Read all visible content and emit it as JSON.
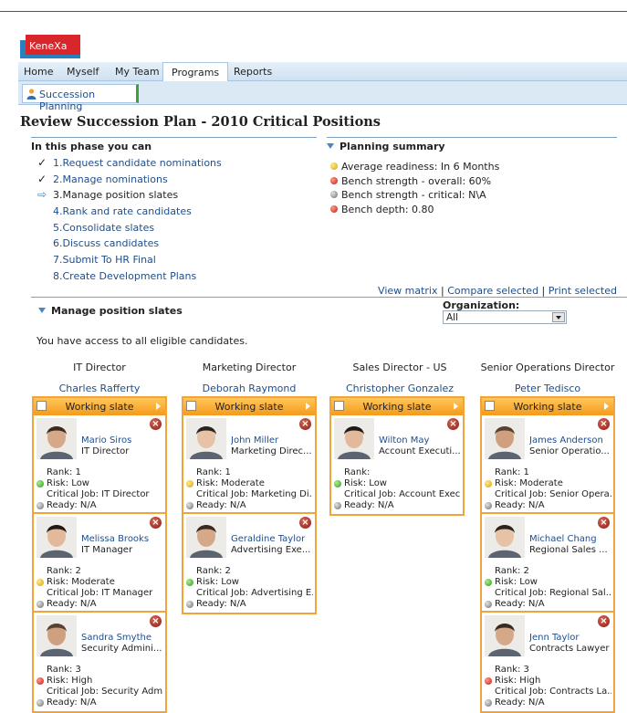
{
  "app": {
    "logo_text": "KeneXa"
  },
  "nav": {
    "items": [
      "Home",
      "Myself",
      "My Team",
      "Programs",
      "Reports"
    ],
    "active": "Programs"
  },
  "subtab": {
    "label": "Succession Planning"
  },
  "page_title": "Review Succession Plan - 2010 Critical Positions",
  "phase": {
    "heading": "In this phase you can",
    "items": [
      {
        "label": "1.Request candidate nominations",
        "mark": "check"
      },
      {
        "label": "2.Manage nominations",
        "mark": "check"
      },
      {
        "label": "3.Manage position slates",
        "mark": "arrow"
      },
      {
        "label": "4.Rank and rate candidates",
        "mark": ""
      },
      {
        "label": "5.Consolidate slates",
        "mark": ""
      },
      {
        "label": "6.Discuss candidates",
        "mark": ""
      },
      {
        "label": "7.Submit To HR Final",
        "mark": ""
      },
      {
        "label": "8.Create Development Plans",
        "mark": ""
      }
    ]
  },
  "summary": {
    "heading": "Planning summary",
    "items": [
      {
        "label": "Average readiness: In 6 Months",
        "color": "yellow"
      },
      {
        "label": "Bench strength - overall: 60%",
        "color": "red"
      },
      {
        "label": "Bench strength - critical: N\\A",
        "color": "gray"
      },
      {
        "label": "Bench depth: 0.80",
        "color": "red"
      }
    ]
  },
  "links": {
    "view_matrix": "View matrix",
    "compare_selected": "Compare selected",
    "print_selected": "Print selected",
    "sep": "|"
  },
  "manage": {
    "heading": "Manage position slates",
    "org_label": "Organization:",
    "org_value": "All",
    "access_text": "You have access to all eligible candidates."
  },
  "slate_label": "Working slate",
  "labels": {
    "rank": "Rank:",
    "risk": "Risk:",
    "critical_job": "Critical Job:",
    "ready": "Ready:"
  },
  "columns": [
    {
      "title": "IT Director",
      "person": "Charles  Rafferty",
      "candidates": [
        {
          "name": "Mario Siros",
          "role": "IT Director",
          "rank": "1",
          "risk": "Low",
          "risk_color": "green",
          "critical_job": "IT Director",
          "ready": "N/A"
        },
        {
          "name": "Melissa Brooks",
          "role": "IT Manager",
          "rank": "2",
          "risk": "Moderate",
          "risk_color": "yellow",
          "critical_job": "IT Manager",
          "ready": "N/A"
        },
        {
          "name": "Sandra Smythe",
          "role": "Security Admini...",
          "rank": "3",
          "risk": "High",
          "risk_color": "red",
          "critical_job": "Security Adm...",
          "ready": "N/A"
        }
      ]
    },
    {
      "title": "Marketing Director",
      "person": "Deborah  Raymond",
      "candidates": [
        {
          "name": "John Miller",
          "role": "Marketing Direc...",
          "rank": "1",
          "risk": "Moderate",
          "risk_color": "yellow",
          "critical_job": "Marketing Di...",
          "ready": "N/A"
        },
        {
          "name": "Geraldine Taylor",
          "role": "Advertising Exe...",
          "rank": "2",
          "risk": "Low",
          "risk_color": "green",
          "critical_job": "Advertising E...",
          "ready": "N/A"
        }
      ]
    },
    {
      "title": "Sales Director - US",
      "person": "Christopher  Gonzalez",
      "candidates": [
        {
          "name": "Wilton May",
          "role": "Account Executi...",
          "rank": "",
          "risk": "Low",
          "risk_color": "green",
          "critical_job": "Account Exec...",
          "ready": "N/A"
        }
      ]
    },
    {
      "title": "Senior Operations Director",
      "person": "Peter  Tedisco",
      "candidates": [
        {
          "name": "James Anderson",
          "role": "Senior Operatio...",
          "rank": "1",
          "risk": "Moderate",
          "risk_color": "yellow",
          "critical_job": "Senior Opera...",
          "ready": "N/A"
        },
        {
          "name": "Michael Chang",
          "role": "Regional Sales ...",
          "rank": "2",
          "risk": "Low",
          "risk_color": "green",
          "critical_job": "Regional Sal...",
          "ready": "N/A"
        },
        {
          "name": "Jenn Taylor",
          "role": "Contracts Lawyer",
          "rank": "3",
          "risk": "High",
          "risk_color": "red",
          "critical_job": "Contracts La...",
          "ready": "N/A"
        }
      ]
    }
  ]
}
